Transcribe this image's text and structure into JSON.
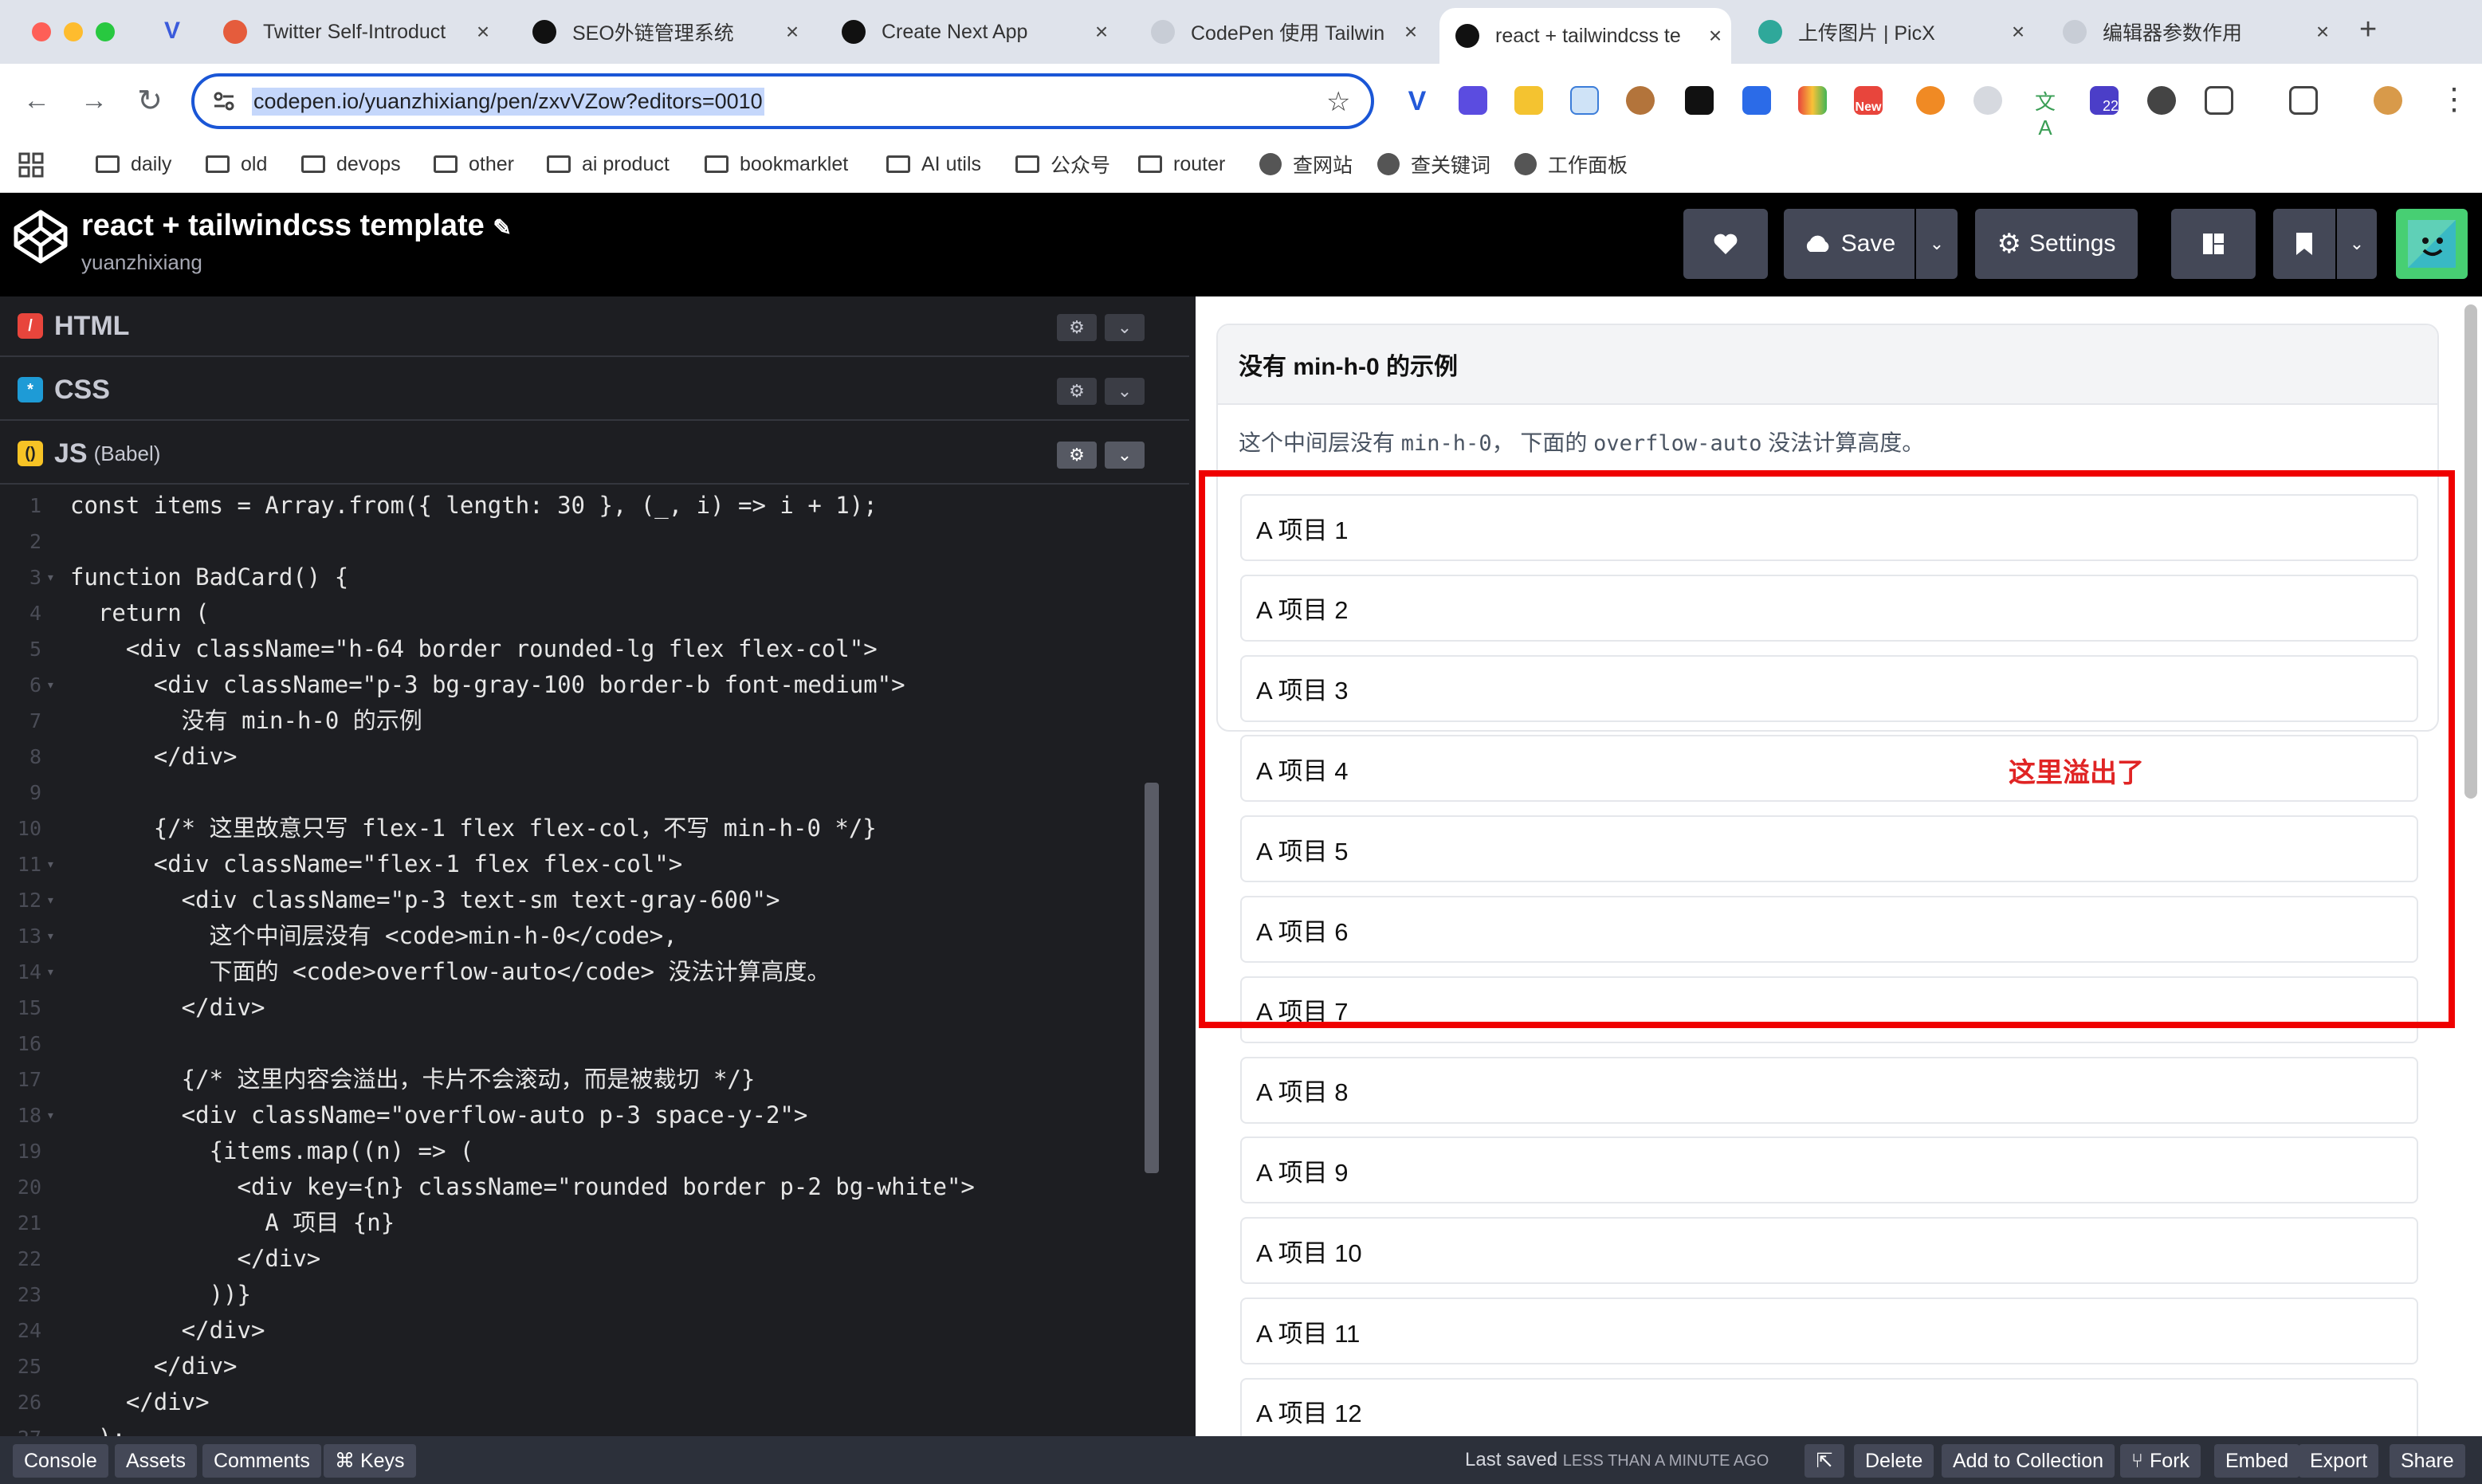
{
  "browser": {
    "tabs": [
      {
        "title": "Twitter Self-Introduct",
        "favicon": "asterisk-icon",
        "color": "#e55c3c"
      },
      {
        "title": "SEO外链管理系统",
        "favicon": "triangle-icon",
        "color": "#111111"
      },
      {
        "title": "Create Next App",
        "favicon": "triangle-icon",
        "color": "#111111"
      },
      {
        "title": "CodePen 使用 Tailwin",
        "favicon": "globe-icon",
        "color": "#c8cdd6"
      },
      {
        "title": "react + tailwindcss te",
        "favicon": "codepen-icon",
        "color": "#111111",
        "active": true
      },
      {
        "title": "上传图片 | PicX",
        "favicon": "picx-icon",
        "color": "#2fa89a"
      },
      {
        "title": "编辑器参数作用",
        "favicon": "globe-icon",
        "color": "#c8cdd6"
      }
    ],
    "new_tab": "+",
    "url": "codepen.io/yuanzhixiang/pen/zxvVZow?editors=0010",
    "bookmarks": [
      {
        "label": "daily",
        "icon": "folder-icon"
      },
      {
        "label": "old",
        "icon": "folder-icon"
      },
      {
        "label": "devops",
        "icon": "folder-icon"
      },
      {
        "label": "other",
        "icon": "folder-icon"
      },
      {
        "label": "ai product",
        "icon": "folder-icon"
      },
      {
        "label": "bookmarklet",
        "icon": "folder-icon"
      },
      {
        "label": "AI utils",
        "icon": "folder-icon"
      },
      {
        "label": "公众号",
        "icon": "folder-icon"
      },
      {
        "label": "router",
        "icon": "folder-icon"
      },
      {
        "label": "查网站",
        "icon": "globe-icon"
      },
      {
        "label": "查关键词",
        "icon": "globe-icon"
      },
      {
        "label": "工作面板",
        "icon": "globe-icon"
      }
    ],
    "extension_badges": {
      "new": "New",
      "count": "22"
    }
  },
  "codepen": {
    "title": "react + tailwindcss template",
    "author": "yuanzhixiang",
    "buttons": {
      "save": "Save",
      "settings": "Settings"
    },
    "panes": {
      "html": "HTML",
      "css": "CSS",
      "js": "JS",
      "js_sub": "(Babel)"
    },
    "code_lines": [
      "const items = Array.from({ length: 30 }, (_, i) => i + 1);",
      "",
      "function BadCard() {",
      "  return (",
      "    <div className=\"h-64 border rounded-lg flex flex-col\">",
      "      <div className=\"p-3 bg-gray-100 border-b font-medium\">",
      "        没有 min-h-0 的示例",
      "      </div>",
      "",
      "      {/* 这里故意只写 flex-1 flex flex-col，不写 min-h-0 */}",
      "      <div className=\"flex-1 flex flex-col\">",
      "        <div className=\"p-3 text-sm text-gray-600\">",
      "          这个中间层没有 <code>min-h-0</code>,",
      "          下面的 <code>overflow-auto</code> 没法计算高度。",
      "        </div>",
      "",
      "        {/* 这里内容会溢出，卡片不会滚动，而是被裁切 */}",
      "        <div className=\"overflow-auto p-3 space-y-2\">",
      "          {items.map((n) => (",
      "            <div key={n} className=\"rounded border p-2 bg-white\">",
      "              A 项目 {n}",
      "            </div>",
      "          ))}",
      "        </div>",
      "      </div>",
      "    </div>",
      "  );"
    ],
    "footer": {
      "console": "Console",
      "assets": "Assets",
      "comments": "Comments",
      "keys": "⌘ Keys",
      "last_saved": "Last saved",
      "last_saved_time": "LESS THAN A MINUTE AGO",
      "delete": "Delete",
      "add_to_collection": "Add to Collection",
      "fork": "Fork",
      "embed": "Embed",
      "export": "Export",
      "share": "Share"
    }
  },
  "preview": {
    "card_title": "没有 min-h-0 的示例",
    "card_desc_1": "这个中间层没有 ",
    "card_desc_code1": "min-h-0",
    "card_desc_2": "， 下面的 ",
    "card_desc_code2": "overflow-auto",
    "card_desc_3": " 没法计算高度。",
    "items": [
      "A 项目 1",
      "A 项目 2",
      "A 项目 3",
      "A 项目 4",
      "A 项目 5",
      "A 项目 6",
      "A 项目 7",
      "A 项目 8",
      "A 项目 9",
      "A 项目 10",
      "A 项目 11",
      "A 项目 12"
    ],
    "annotation": "这里溢出了",
    "annotation_color": "#e02424",
    "highlight_color": "#ef0000"
  }
}
